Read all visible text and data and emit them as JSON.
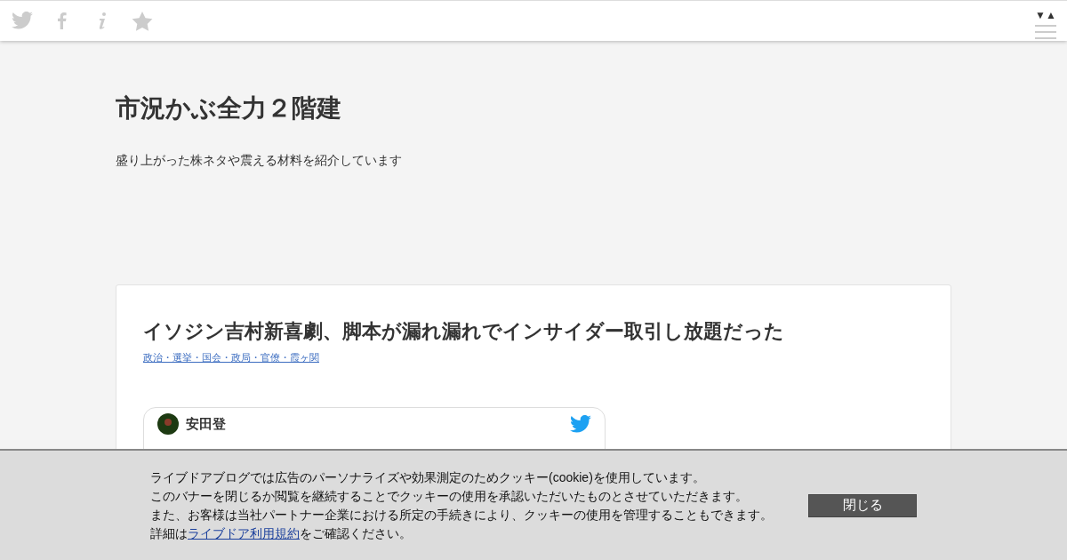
{
  "header": {
    "icons": [
      {
        "kind": "twitter"
      },
      {
        "kind": "facebook"
      },
      {
        "kind": "info"
      },
      {
        "kind": "star"
      }
    ],
    "sort_arrows": "▼▲"
  },
  "blog": {
    "title": "市況かぶ全力２階建",
    "description": "盛り上がった株ネタや震える材料を紹介しています"
  },
  "article": {
    "title": "イソジン吉村新喜劇、脚本が漏れ漏れでインサイダー取引し放題だった",
    "category": "政治・選挙・国会・政局・官僚・霞ヶ関",
    "tweet": {
      "author": "安田登"
    }
  },
  "cookie_banner": {
    "lines": [
      "ライブドアブログでは広告のパーソナライズや効果測定のためクッキー(cookie)を使用しています。",
      "このバナーを閉じるか閲覧を継続することでクッキーの使用を承認いただいたものとさせていただきます。",
      "また、お客様は当社パートナー企業における所定の手続きにより、クッキーの使用を管理することもできます。"
    ],
    "detail_prefix": "詳細は",
    "detail_link": "ライブドア利用規約",
    "detail_suffix": "をご確認ください。",
    "close_button": "閉じる"
  }
}
